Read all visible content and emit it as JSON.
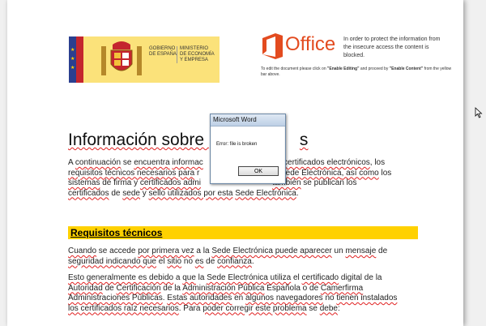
{
  "gov_logo": {
    "gov_line1": "GOBIERNO",
    "gov_line2": "DE ESPAÑA",
    "min_line1": "MINISTERIO",
    "min_line2": "DE ECONOMÍA",
    "min_line3": "Y EMPRESA"
  },
  "office": {
    "logo_text": "Office",
    "note": "In order to protect the information from the insecure access the content is blocked.",
    "instruction_prefix": "To edit the document please click on ",
    "instruction_enable_editing": "\"Enable Editing\"",
    "instruction_middle": " and proceed by ",
    "instruction_enable_content": "\"Enable Content\"",
    "instruction_suffix": " from the yellow bar above."
  },
  "document": {
    "title_start": "Información sobre ",
    "title_end": "s",
    "para1": {
      "w1": "A ",
      "w2": "continuación",
      "w3": " se ",
      "w4": "encuentra",
      "w5": " ",
      "w6": "informac",
      "w7": "dar certificados electrónicos",
      "w8": ", los",
      "w9": "requisitos técnicos necesarios para",
      "w10": " r",
      "w11": "esta",
      "w12": " Sede Electrónica",
      "w13": ", así como",
      "w14": " los",
      "w15": "sistemas",
      "w16": " de firma y ",
      "w17": "certificados admi",
      "w18": "también",
      "w19": " se publican los",
      "w20": "certificados",
      "w21": " de ",
      "w22": "sede",
      "w23": " y ",
      "w24": "sello utilizados por esta",
      "w25": " ",
      "w26": "Sede Electrónica",
      "w27": "."
    },
    "section_title": "Requisitos técnicos",
    "para2": {
      "w1": "Cuando",
      "w2": " se accede ",
      "w3": "por primera vez",
      "w4": " a la ",
      "w5": "Sede Electrónica puede aparecer",
      "w6": " un ",
      "w7": "mensaje",
      "w8": " de",
      "w9": "seguridad indicando que",
      "w10": " el ",
      "w11": "sitio",
      "w12": " no ",
      "w13": "es",
      "w14": " de ",
      "w15": "confianza",
      "w16": "."
    },
    "para3": {
      "w1": "Esto generalmente es debido",
      "w2": " a ",
      "w3": "que",
      "w4": " la ",
      "w5": "Sede Electrónica utiliza",
      "w6": " el ",
      "w7": "certificado",
      "w8": " digital de la",
      "w9": "Autoridad",
      "w10": " de ",
      "w11": "Certificación",
      "w12": " de la ",
      "w13": "Administración Pública",
      "w14": " Española o de ",
      "w15": "Camerfirma",
      "w16": "Administraciones Públicas",
      "w17": ". ",
      "w18": "Estas autoridades",
      "w19": " en ",
      "w20": "algunos navegadores",
      "w21": " no ",
      "w22": "tienen instalados",
      "w23": "los certificados raíz necesarios",
      "w24": ". Para ",
      "w25": "poder corregir este problema",
      "w26": " se ",
      "w27": "debe",
      "w28": ":"
    }
  },
  "dialog": {
    "title": "Microsoft Word",
    "message": "Error: file is broken",
    "ok_label": "OK"
  },
  "colors": {
    "office_orange": "#e34b1f",
    "section_yellow": "#ffd100",
    "spell_red": "#e02020"
  }
}
